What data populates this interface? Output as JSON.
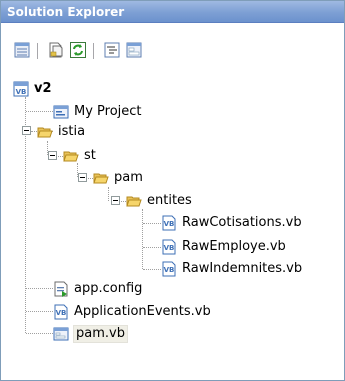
{
  "window": {
    "title": "Solution Explorer"
  },
  "toolbar": {
    "buttons": [
      {
        "name": "properties-button",
        "icon": "properties-icon"
      },
      {
        "name": "show-all-files-button",
        "icon": "show-all-files-icon"
      },
      {
        "name": "refresh-button",
        "icon": "refresh-icon"
      },
      {
        "name": "view-code-button",
        "icon": "view-code-icon"
      },
      {
        "name": "view-designer-button",
        "icon": "view-designer-icon"
      }
    ]
  },
  "tree": {
    "root": {
      "label": "v2",
      "icon": "vb-project-icon"
    },
    "my_project": {
      "label": "My Project",
      "icon": "my-project-icon"
    },
    "istia": {
      "label": "istia",
      "icon": "folder-open-icon"
    },
    "st": {
      "label": "st",
      "icon": "folder-open-icon"
    },
    "pam": {
      "label": "pam",
      "icon": "folder-open-icon"
    },
    "entites": {
      "label": "entites",
      "icon": "folder-open-icon"
    },
    "files_entites": [
      {
        "label": "RawCotisations.vb",
        "icon": "vb-file-icon"
      },
      {
        "label": "RawEmploye.vb",
        "icon": "vb-file-icon"
      },
      {
        "label": "RawIndemnites.vb",
        "icon": "vb-file-icon"
      }
    ],
    "app_config": {
      "label": "app.config",
      "icon": "config-file-icon"
    },
    "application_events": {
      "label": "ApplicationEvents.vb",
      "icon": "vb-file-icon"
    },
    "pam_vb": {
      "label": "pam.vb",
      "icon": "vb-form-icon",
      "selected": true
    }
  },
  "colors": {
    "title_bar": "#7d9fd4",
    "folder": "#f6d56b",
    "vb_icon": "#3d6fb6"
  }
}
